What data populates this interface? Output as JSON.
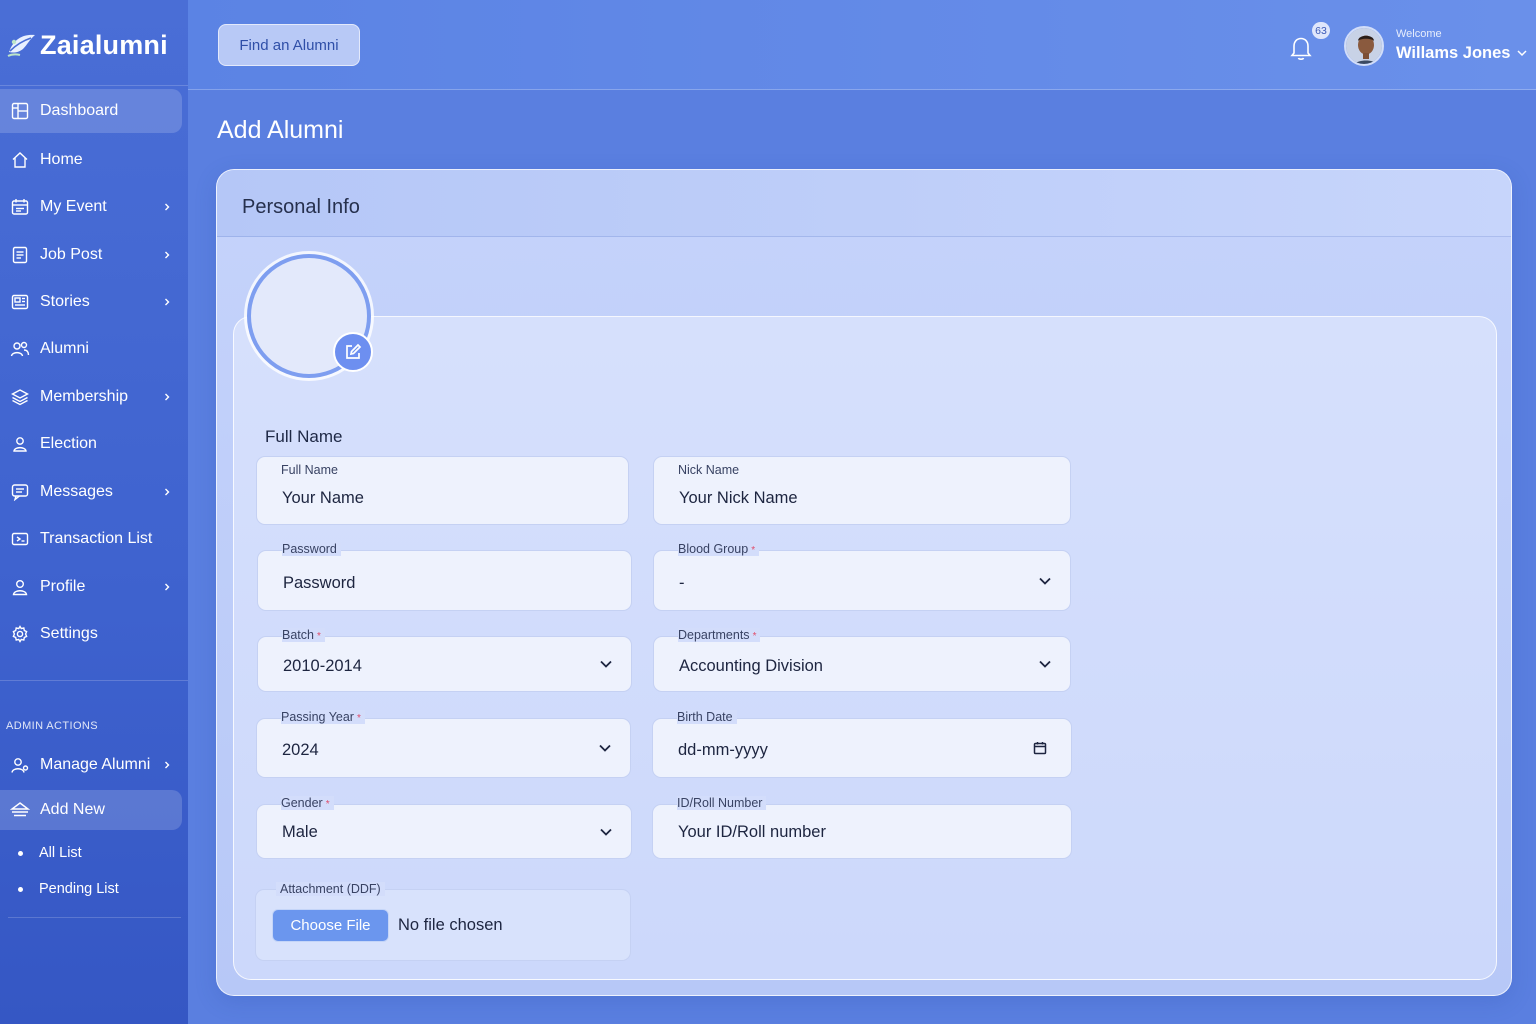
{
  "brand": {
    "name": "Zaialumni"
  },
  "sidebar": {
    "items": [
      {
        "label": "Dashboard",
        "icon": "dashboard-icon",
        "active": true,
        "has_submenu": false
      },
      {
        "label": "Home",
        "icon": "home-icon",
        "active": false,
        "has_submenu": false
      },
      {
        "label": "My Event",
        "icon": "calendar-icon",
        "active": false,
        "has_submenu": true
      },
      {
        "label": "Job Post",
        "icon": "document-icon",
        "active": false,
        "has_submenu": true
      },
      {
        "label": "Stories",
        "icon": "newspaper-icon",
        "active": false,
        "has_submenu": true
      },
      {
        "label": "Alumni",
        "icon": "users-icon",
        "active": false,
        "has_submenu": false
      },
      {
        "label": "Membership",
        "icon": "layers-icon",
        "active": false,
        "has_submenu": true
      },
      {
        "label": "Election",
        "icon": "ballot-icon",
        "active": false,
        "has_submenu": false
      },
      {
        "label": "Messages",
        "icon": "message-icon",
        "active": false,
        "has_submenu": true
      },
      {
        "label": "Transaction List",
        "icon": "transaction-icon",
        "active": false,
        "has_submenu": false
      },
      {
        "label": "Profile",
        "icon": "user-icon",
        "active": false,
        "has_submenu": true
      },
      {
        "label": "Settings",
        "icon": "gear-icon",
        "active": false,
        "has_submenu": false
      }
    ],
    "admin_heading": "ADMIN ACTIONS",
    "admin_items": [
      {
        "label": "Manage Alumni",
        "icon": "manage-users-icon",
        "active": false,
        "has_submenu": true
      },
      {
        "label": "Add New",
        "icon": "add-user-icon",
        "active": true,
        "has_submenu": false
      }
    ],
    "sub_items": [
      {
        "label": "All List"
      },
      {
        "label": "Pending List"
      }
    ]
  },
  "topbar": {
    "find_button": "Find an Alumni",
    "notification_count": "63",
    "welcome": "Welcome",
    "user_name": "Willams Jones"
  },
  "page": {
    "title": "Add Alumni",
    "card_title": "Personal Info",
    "section_label": "Full Name"
  },
  "form": {
    "full_name": {
      "label": "Full Name",
      "placeholder": "Your Name"
    },
    "nick_name": {
      "label": "Nick Name",
      "placeholder": "Your Nick Name"
    },
    "password": {
      "label": "Password",
      "placeholder": "Password"
    },
    "blood_group": {
      "label": "Blood Group",
      "value": "-",
      "required": true
    },
    "batch": {
      "label": "Batch",
      "value": "2010-2014",
      "required": true
    },
    "departments": {
      "label": "Departments",
      "value": "Accounting Division",
      "required": true
    },
    "passing_year": {
      "label": "Passing Year",
      "value": "2024",
      "required": true
    },
    "birth_date": {
      "label": "Birth Date",
      "placeholder": "dd-mm-yyyy"
    },
    "gender": {
      "label": "Gender",
      "value": "Male",
      "required": true
    },
    "roll_number": {
      "label": "ID/Roll Number",
      "placeholder": "Your ID/Roll number"
    },
    "attachment": {
      "label": "Attachment (DDF)",
      "button": "Choose File",
      "status": "No file chosen"
    }
  },
  "colors": {
    "sidebar_bg": "#4266d2",
    "accent": "#6b96ee",
    "required": "#e04c6a"
  }
}
